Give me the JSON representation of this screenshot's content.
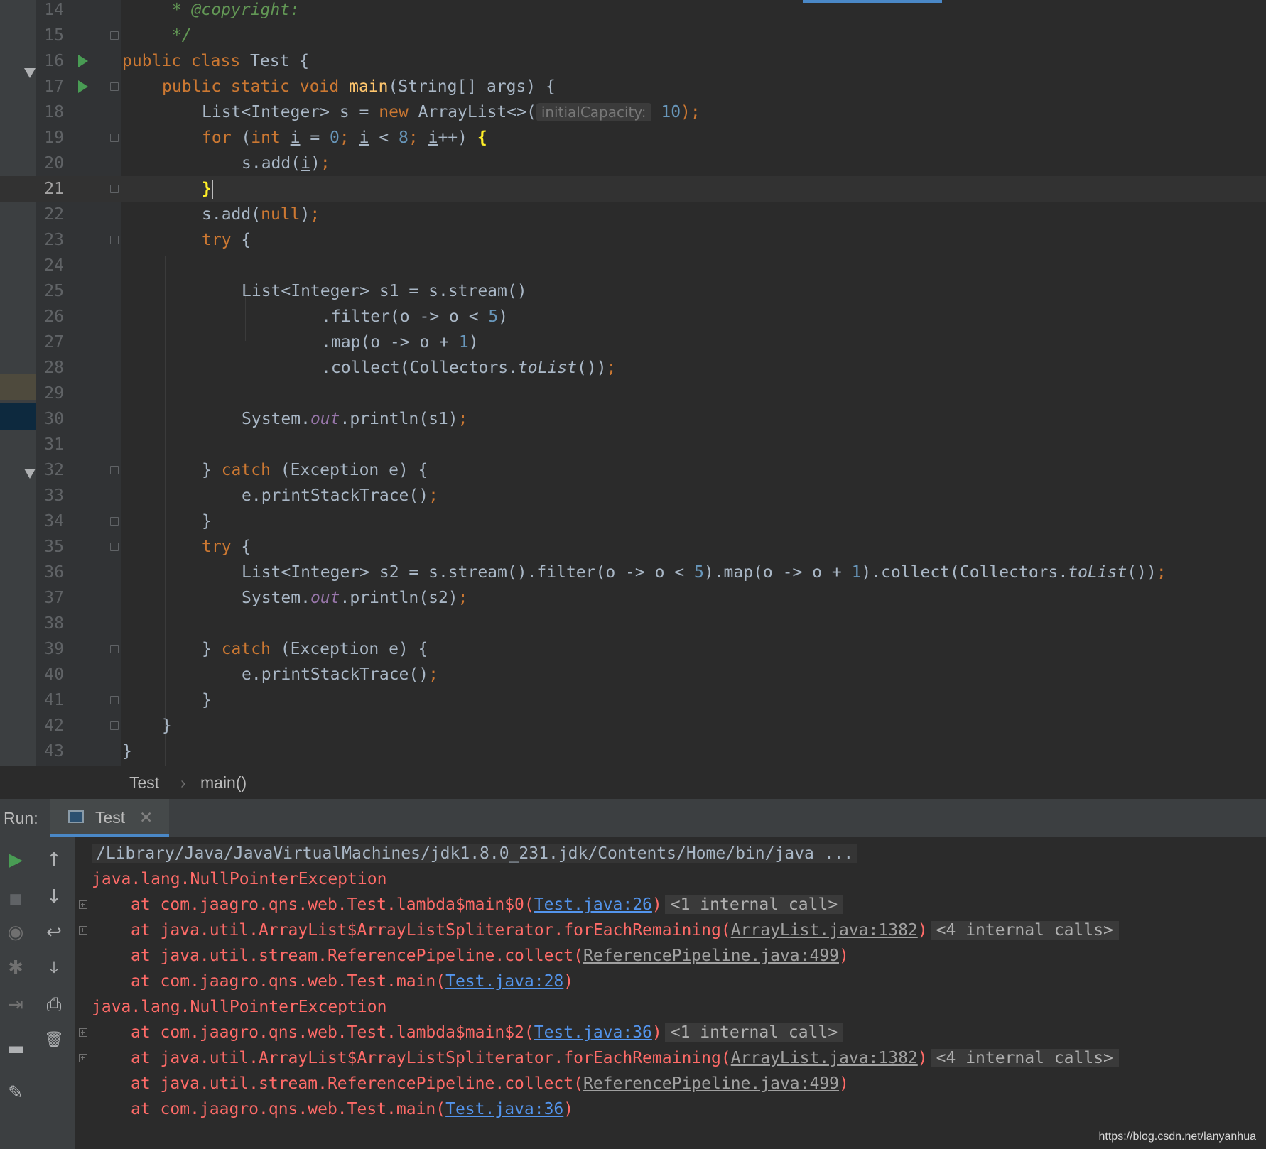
{
  "editor": {
    "lines": [
      {
        "n": "14",
        "segs": [
          {
            "t": " * ",
            "c": "cm"
          },
          {
            "t": "@copyright:",
            "c": "cm"
          }
        ],
        "indent": 1
      },
      {
        "n": "15",
        "segs": [
          {
            "t": " */",
            "c": "cm"
          }
        ],
        "indent": 1
      },
      {
        "n": "16",
        "segs": [
          {
            "t": "public class ",
            "c": "kw"
          },
          {
            "t": "Test {",
            "c": ""
          }
        ],
        "indent": 0
      },
      {
        "n": "17",
        "segs": [
          {
            "t": "public static void ",
            "c": "kw"
          },
          {
            "t": "main",
            "c": "fn"
          },
          {
            "t": "(String[] args) {",
            "c": ""
          }
        ],
        "indent": 1
      },
      {
        "n": "18",
        "segs": [
          {
            "t": "List<Integer> s = ",
            "c": ""
          },
          {
            "t": "new ",
            "c": "kw"
          },
          {
            "t": "ArrayList<>(",
            "c": ""
          },
          {
            "t": "initialCapacity:",
            "c": "hint"
          },
          {
            "t": " 10",
            "c": "num"
          },
          {
            "t": ");",
            "c": "kw"
          }
        ],
        "indent": 2
      },
      {
        "n": "19",
        "segs": [
          {
            "t": "for ",
            "c": "kw"
          },
          {
            "t": "(",
            "c": ""
          },
          {
            "t": "int ",
            "c": "kw"
          },
          {
            "t": "i",
            "c": "ul"
          },
          {
            "t": " = ",
            "c": ""
          },
          {
            "t": "0",
            "c": "num"
          },
          {
            "t": "; ",
            "c": "kw"
          },
          {
            "t": "i",
            "c": "ul"
          },
          {
            "t": " < ",
            "c": ""
          },
          {
            "t": "8",
            "c": "num"
          },
          {
            "t": "; ",
            "c": "kw"
          },
          {
            "t": "i",
            "c": "ul"
          },
          {
            "t": "++) ",
            "c": ""
          },
          {
            "t": "{",
            "c": "brace-hl"
          }
        ],
        "indent": 2
      },
      {
        "n": "20",
        "segs": [
          {
            "t": "s.add(",
            "c": ""
          },
          {
            "t": "i",
            "c": "ul"
          },
          {
            "t": ")",
            "c": ""
          },
          {
            "t": ";",
            "c": "kw"
          }
        ],
        "indent": 3
      },
      {
        "n": "21",
        "segs": [
          {
            "t": "}",
            "c": "brace-hl"
          }
        ],
        "indent": 2,
        "current": true
      },
      {
        "n": "22",
        "segs": [
          {
            "t": "s.add(",
            "c": ""
          },
          {
            "t": "null",
            "c": "kw"
          },
          {
            "t": ")",
            "c": ""
          },
          {
            "t": ";",
            "c": "kw"
          }
        ],
        "indent": 2
      },
      {
        "n": "23",
        "segs": [
          {
            "t": "try ",
            "c": "kw"
          },
          {
            "t": "{",
            "c": ""
          }
        ],
        "indent": 2
      },
      {
        "n": "24",
        "segs": [],
        "indent": 2
      },
      {
        "n": "25",
        "segs": [
          {
            "t": "List<Integer> s1 = s.stream()",
            "c": ""
          }
        ],
        "indent": 3
      },
      {
        "n": "26",
        "segs": [
          {
            "t": ".filter(o -> o < ",
            "c": ""
          },
          {
            "t": "5",
            "c": "num"
          },
          {
            "t": ")",
            "c": ""
          }
        ],
        "indent": 5
      },
      {
        "n": "27",
        "segs": [
          {
            "t": ".map(o -> o + ",
            "c": ""
          },
          {
            "t": "1",
            "c": "num"
          },
          {
            "t": ")",
            "c": ""
          }
        ],
        "indent": 5
      },
      {
        "n": "28",
        "segs": [
          {
            "t": ".collect(Collectors.",
            "c": ""
          },
          {
            "t": "toList",
            "c": "it"
          },
          {
            "t": "())",
            "c": ""
          },
          {
            "t": ";",
            "c": "kw"
          }
        ],
        "indent": 5
      },
      {
        "n": "29",
        "segs": [],
        "indent": 3
      },
      {
        "n": "30",
        "segs": [
          {
            "t": "System.",
            "c": ""
          },
          {
            "t": "out",
            "c": "fld"
          },
          {
            "t": ".println(s1)",
            "c": ""
          },
          {
            "t": ";",
            "c": "kw"
          }
        ],
        "indent": 3
      },
      {
        "n": "31",
        "segs": [],
        "indent": 3
      },
      {
        "n": "32",
        "segs": [
          {
            "t": "} ",
            "c": ""
          },
          {
            "t": "catch ",
            "c": "kw"
          },
          {
            "t": "(Exception e) {",
            "c": ""
          }
        ],
        "indent": 2
      },
      {
        "n": "33",
        "segs": [
          {
            "t": "e.printStackTrace()",
            "c": ""
          },
          {
            "t": ";",
            "c": "kw"
          }
        ],
        "indent": 3
      },
      {
        "n": "34",
        "segs": [
          {
            "t": "}",
            "c": ""
          }
        ],
        "indent": 2
      },
      {
        "n": "35",
        "segs": [
          {
            "t": "try ",
            "c": "kw"
          },
          {
            "t": "{",
            "c": ""
          }
        ],
        "indent": 2
      },
      {
        "n": "36",
        "segs": [
          {
            "t": "List<Integer> s2 = s.stream().filter(o -> o < ",
            "c": ""
          },
          {
            "t": "5",
            "c": "num"
          },
          {
            "t": ").map(o -> o + ",
            "c": ""
          },
          {
            "t": "1",
            "c": "num"
          },
          {
            "t": ").collect(Collectors.",
            "c": ""
          },
          {
            "t": "toList",
            "c": "it"
          },
          {
            "t": "())",
            "c": ""
          },
          {
            "t": ";",
            "c": "kw"
          }
        ],
        "indent": 3
      },
      {
        "n": "37",
        "segs": [
          {
            "t": "System.",
            "c": ""
          },
          {
            "t": "out",
            "c": "fld"
          },
          {
            "t": ".println(s2)",
            "c": ""
          },
          {
            "t": ";",
            "c": "kw"
          }
        ],
        "indent": 3
      },
      {
        "n": "38",
        "segs": [],
        "indent": 3
      },
      {
        "n": "39",
        "segs": [
          {
            "t": "} ",
            "c": ""
          },
          {
            "t": "catch ",
            "c": "kw"
          },
          {
            "t": "(Exception e) {",
            "c": ""
          }
        ],
        "indent": 2
      },
      {
        "n": "40",
        "segs": [
          {
            "t": "e.printStackTrace()",
            "c": ""
          },
          {
            "t": ";",
            "c": "kw"
          }
        ],
        "indent": 3
      },
      {
        "n": "41",
        "segs": [
          {
            "t": "}",
            "c": ""
          }
        ],
        "indent": 2
      },
      {
        "n": "42",
        "segs": [
          {
            "t": "}",
            "c": ""
          }
        ],
        "indent": 1
      },
      {
        "n": "43",
        "segs": [
          {
            "t": "}",
            "c": ""
          }
        ],
        "indent": 0
      }
    ]
  },
  "breadcrumb": {
    "class_name": "Test",
    "separator": "›",
    "method_name": "main()"
  },
  "run_panel": {
    "label": "Run:",
    "tab_label": "Test",
    "tab_close": "✕",
    "console": [
      {
        "segs": [
          {
            "t": "/Library/Java/JavaVirtualMachines/jdk1.8.0_231.jdk/Contents/Home/bin/java ...",
            "c": "cmd"
          }
        ],
        "plus": false,
        "indent": 0
      },
      {
        "segs": [
          {
            "t": "java.lang.NullPointerException",
            "c": ""
          }
        ],
        "plus": false,
        "indent": 0
      },
      {
        "segs": [
          {
            "t": "at com.jaagro.qns.web.Test.lambda$main$0(",
            "c": ""
          },
          {
            "t": "Test.java:26",
            "c": "lnk"
          },
          {
            "t": ")",
            "c": ""
          },
          {
            "t": "<1 internal call>",
            "c": "internal"
          }
        ],
        "plus": true,
        "indent": 1
      },
      {
        "segs": [
          {
            "t": "at java.util.ArrayList$ArrayListSpliterator.forEachRemaining(",
            "c": ""
          },
          {
            "t": "ArrayList.java:1382",
            "c": "lnk-g"
          },
          {
            "t": ")",
            "c": ""
          },
          {
            "t": "<4 internal calls>",
            "c": "internal"
          }
        ],
        "plus": true,
        "indent": 1
      },
      {
        "segs": [
          {
            "t": "at java.util.stream.ReferencePipeline.collect(",
            "c": ""
          },
          {
            "t": "ReferencePipeline.java:499",
            "c": "lnk-g"
          },
          {
            "t": ")",
            "c": ""
          }
        ],
        "plus": false,
        "indent": 1
      },
      {
        "segs": [
          {
            "t": "at com.jaagro.qns.web.Test.main(",
            "c": ""
          },
          {
            "t": "Test.java:28",
            "c": "lnk"
          },
          {
            "t": ")",
            "c": ""
          }
        ],
        "plus": false,
        "indent": 1
      },
      {
        "segs": [
          {
            "t": "java.lang.NullPointerException",
            "c": ""
          }
        ],
        "plus": false,
        "indent": 0
      },
      {
        "segs": [
          {
            "t": "at com.jaagro.qns.web.Test.lambda$main$2(",
            "c": ""
          },
          {
            "t": "Test.java:36",
            "c": "lnk"
          },
          {
            "t": ")",
            "c": ""
          },
          {
            "t": "<1 internal call>",
            "c": "internal"
          }
        ],
        "plus": true,
        "indent": 1
      },
      {
        "segs": [
          {
            "t": "at java.util.ArrayList$ArrayListSpliterator.forEachRemaining(",
            "c": ""
          },
          {
            "t": "ArrayList.java:1382",
            "c": "lnk-g"
          },
          {
            "t": ")",
            "c": ""
          },
          {
            "t": "<4 internal calls>",
            "c": "internal"
          }
        ],
        "plus": true,
        "indent": 1
      },
      {
        "segs": [
          {
            "t": "at java.util.stream.ReferencePipeline.collect(",
            "c": ""
          },
          {
            "t": "ReferencePipeline.java:499",
            "c": "lnk-g"
          },
          {
            "t": ")",
            "c": ""
          }
        ],
        "plus": false,
        "indent": 1
      },
      {
        "segs": [
          {
            "t": "at com.jaagro.qns.web.Test.main(",
            "c": ""
          },
          {
            "t": "Test.java:36",
            "c": "lnk"
          },
          {
            "t": ")",
            "c": ""
          }
        ],
        "plus": false,
        "indent": 1
      }
    ]
  },
  "toolbar_icons": {
    "rerun": "▶",
    "stop": "■",
    "snapshot": "◉",
    "debug": "✱",
    "exit": "⇥",
    "layout": "▬",
    "pin": "✎",
    "up": "↑",
    "down": "↓",
    "wrap": "↩",
    "scroll_end": "⤓",
    "print": "⎙",
    "trash": "🗑"
  },
  "colors": {
    "keyword": "#cc7832",
    "number": "#6897bb",
    "method": "#ffc66d",
    "error": "#ff6b68",
    "link": "#5394ec",
    "run": "#499c54",
    "accent": "#4a88c7"
  },
  "watermark": "https://blog.csdn.net/lanyanhua"
}
